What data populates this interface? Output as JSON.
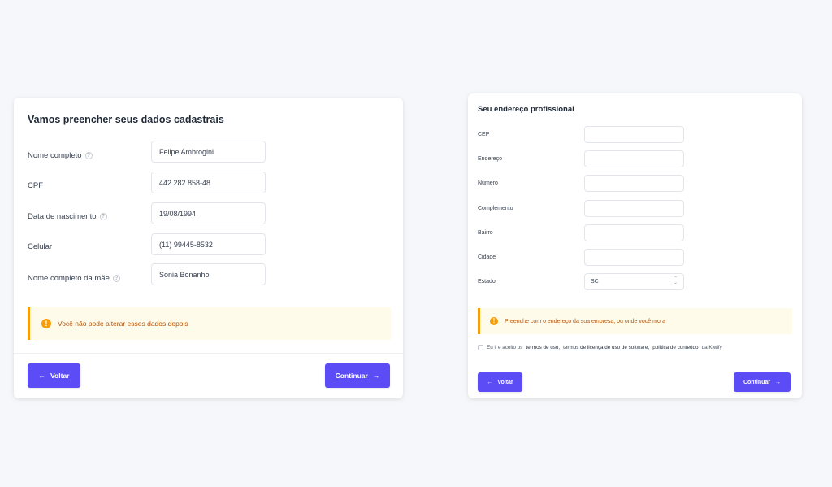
{
  "personal": {
    "title": "Vamos preencher seus dados cadastrais",
    "fields": [
      {
        "label": "Nome completo",
        "value": "Felipe Ambrogini",
        "help": true
      },
      {
        "label": "CPF",
        "value": "442.282.858-48",
        "help": false
      },
      {
        "label": "Data de nascimento",
        "value": "19/08/1994",
        "help": true
      },
      {
        "label": "Celular",
        "value": "(11) 99445-8532",
        "help": false
      },
      {
        "label": "Nome completo da mãe",
        "value": "Sonia Bonanho",
        "help": true
      }
    ],
    "alert": "Você não pode alterar esses dados depois",
    "back_label": "Voltar",
    "continue_label": "Continuar"
  },
  "address": {
    "title": "Seu endereço profissional",
    "fields": [
      {
        "label": "CEP",
        "value": ""
      },
      {
        "label": "Endereço",
        "value": ""
      },
      {
        "label": "Número",
        "value": ""
      },
      {
        "label": "Complemento",
        "value": ""
      },
      {
        "label": "Bairro",
        "value": ""
      },
      {
        "label": "Cidade",
        "value": ""
      },
      {
        "label": "Estado",
        "value": "SC"
      }
    ],
    "alert": "Preenche com o endereço da sua empresa, ou onde você mora",
    "terms": {
      "prefix": "Eu li e aceito os",
      "link1": "termos de uso",
      "sep1": ",",
      "link2": "termos de licença de uso de software",
      "sep2": ",",
      "link3": "política de conteúdo",
      "suffix": "da Kiwify"
    },
    "back_label": "Voltar",
    "continue_label": "Continuar"
  },
  "icons": {
    "help": "?",
    "alert": "!",
    "arrow_left": "←",
    "arrow_right": "→",
    "select_up": "⌃",
    "select_down": "⌄"
  },
  "colors": {
    "primary": "#5b4cf5",
    "warning": "#f59e0b",
    "warning_bg": "#fffbea",
    "background": "#f5f7fa"
  }
}
